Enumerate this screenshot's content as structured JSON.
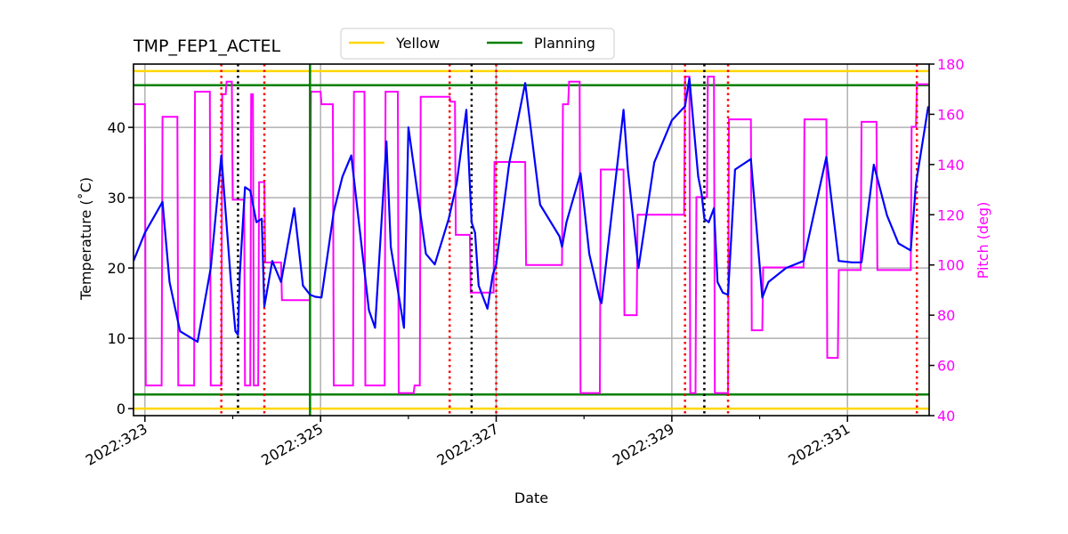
{
  "chart_data": {
    "type": "line",
    "title": "TMP_FEP1_ACTEL",
    "xlabel": "Date",
    "ylabel": "Temperature ($^\\circ$C)",
    "ylabel_display": "Temperature (˚C)",
    "y2label": "Pitch (deg)",
    "xlim": [
      322.87,
      331.93
    ],
    "ylim": [
      -1,
      49
    ],
    "y2lim": [
      40,
      180
    ],
    "x_ticks": [
      {
        "value": 323,
        "label": "2022:323"
      },
      {
        "value": 325,
        "label": "2022:325"
      },
      {
        "value": 327,
        "label": "2022:327"
      },
      {
        "value": 329,
        "label": "2022:329"
      },
      {
        "value": 331,
        "label": "2022:331"
      }
    ],
    "x_minor_ticks": [
      324,
      326,
      328,
      330
    ],
    "y_ticks": [
      0,
      10,
      20,
      30,
      40
    ],
    "y2_ticks": [
      40,
      60,
      80,
      100,
      120,
      140,
      160,
      180
    ],
    "grid": true,
    "legend": {
      "placement": "top-center",
      "entries": [
        {
          "label": "Yellow",
          "color": "#FFD700"
        },
        {
          "label": "Planning",
          "color": "#008000"
        }
      ]
    },
    "colors": {
      "temperature": "#0000FF",
      "pitch": "#FF00FF",
      "yellow": "#FFD700",
      "planning": "#008000",
      "red_marker": "#FF0000",
      "black_marker": "#000000",
      "grid": "#B0B0B0",
      "pitch_axis": "#FF00FF"
    },
    "limits": {
      "yellow": [
        0,
        48
      ],
      "planning": [
        2,
        46
      ]
    },
    "vlines": {
      "red_dotted": [
        323.87,
        324.36,
        326.47,
        327.0,
        329.15,
        329.64,
        331.79
      ],
      "black_dotted": [
        324.06,
        326.72,
        329.37
      ],
      "green_solid": [
        324.88
      ]
    },
    "series": [
      {
        "name": "TMP_FEP1_ACTEL",
        "axis": "left",
        "color": "#0000FF",
        "x": [
          322.87,
          323.0,
          323.2,
          323.28,
          323.4,
          323.6,
          323.75,
          323.87,
          323.98,
          324.03,
          324.06,
          324.08,
          324.14,
          324.2,
          324.27,
          324.33,
          324.36,
          324.45,
          324.55,
          324.7,
          324.8,
          324.88,
          324.94,
          325.01,
          325.15,
          325.25,
          325.35,
          325.55,
          325.62,
          325.75,
          325.8,
          325.95,
          326.0,
          326.2,
          326.3,
          326.46,
          326.55,
          326.66,
          326.72,
          326.76,
          326.8,
          326.9,
          326.96,
          327.0,
          327.15,
          327.33,
          327.5,
          327.72,
          327.75,
          327.8,
          327.96,
          328.06,
          328.18,
          328.2,
          328.45,
          328.5,
          328.62,
          328.8,
          329.0,
          329.15,
          329.2,
          329.25,
          329.3,
          329.34,
          329.37,
          329.42,
          329.48,
          329.52,
          329.58,
          329.64,
          329.72,
          329.9,
          330.03,
          330.1,
          330.3,
          330.5,
          330.76,
          330.9,
          331.05,
          331.16,
          331.3,
          331.45,
          331.58,
          331.72,
          331.78,
          331.92
        ],
        "values": [
          21,
          25,
          29.4,
          18,
          11,
          9.5,
          20,
          36,
          18,
          11,
          10.5,
          19,
          31.5,
          31,
          26.5,
          27,
          14.5,
          21,
          18,
          28.5,
          17.5,
          16.2,
          15.9,
          15.8,
          28,
          33,
          36,
          14,
          11.5,
          38,
          23,
          11.5,
          40,
          22,
          20.5,
          27,
          32,
          42.5,
          26.5,
          25,
          17.5,
          14.2,
          19,
          20.5,
          35,
          46.3,
          29,
          24.5,
          23,
          26.5,
          33.5,
          22,
          15.5,
          15,
          42.5,
          34,
          20,
          35,
          41,
          43,
          47,
          40,
          33,
          30.5,
          27,
          26.5,
          28.5,
          18,
          16.5,
          16.2,
          34,
          35.5,
          15.8,
          18,
          20,
          21,
          35.8,
          21,
          20.8,
          20.8,
          34.7,
          27.5,
          23.5,
          22.5,
          32,
          43
        ]
      },
      {
        "name": "Pitch",
        "axis": "right",
        "color": "#FF00FF",
        "x": [
          322.87,
          323.0,
          323.01,
          323.19,
          323.2,
          323.37,
          323.38,
          323.56,
          323.57,
          323.74,
          323.75,
          323.87,
          323.88,
          323.92,
          323.93,
          323.99,
          324.0,
          324.13,
          324.14,
          324.2,
          324.21,
          324.23,
          324.24,
          324.29,
          324.3,
          324.36,
          324.37,
          324.55,
          324.56,
          324.88,
          324.89,
          325.0,
          325.01,
          325.14,
          325.15,
          325.37,
          325.38,
          325.5,
          325.51,
          325.73,
          325.74,
          325.88,
          325.89,
          326.06,
          326.07,
          326.13,
          326.14,
          326.3,
          326.31,
          326.47,
          326.48,
          326.53,
          326.54,
          326.7,
          326.71,
          326.97,
          326.98,
          327.33,
          327.34,
          327.75,
          327.76,
          327.82,
          327.83,
          327.95,
          327.96,
          328.18,
          328.19,
          328.45,
          328.46,
          328.6,
          328.61,
          329.14,
          329.15,
          329.2,
          329.21,
          329.27,
          329.28,
          329.4,
          329.41,
          329.48,
          329.49,
          329.64,
          329.65,
          329.9,
          329.91,
          330.03,
          330.04,
          330.5,
          330.51,
          330.76,
          330.77,
          330.89,
          330.9,
          331.15,
          331.16,
          331.33,
          331.34,
          331.72,
          331.73,
          331.78,
          331.79,
          331.92
        ],
        "values": [
          164,
          164,
          52,
          52,
          159,
          159,
          52,
          52,
          169,
          169,
          52,
          52,
          168,
          168,
          173,
          173,
          126,
          126,
          52,
          52,
          168,
          168,
          52,
          52,
          133,
          133,
          101,
          101,
          86,
          86,
          169,
          169,
          164,
          164,
          52,
          52,
          169,
          169,
          52,
          52,
          169,
          169,
          49,
          49,
          52,
          52,
          167,
          167,
          167,
          167,
          165,
          165,
          112,
          112,
          89,
          89,
          141,
          141,
          100,
          100,
          164,
          164,
          173,
          173,
          49,
          49,
          138,
          138,
          80,
          80,
          120,
          120,
          175,
          175,
          49,
          49,
          127,
          127,
          175,
          175,
          49,
          49,
          158,
          158,
          74,
          74,
          99,
          99,
          158,
          158,
          63,
          63,
          98,
          98,
          157,
          157,
          98,
          98,
          155,
          155,
          172,
          172
        ]
      }
    ]
  }
}
